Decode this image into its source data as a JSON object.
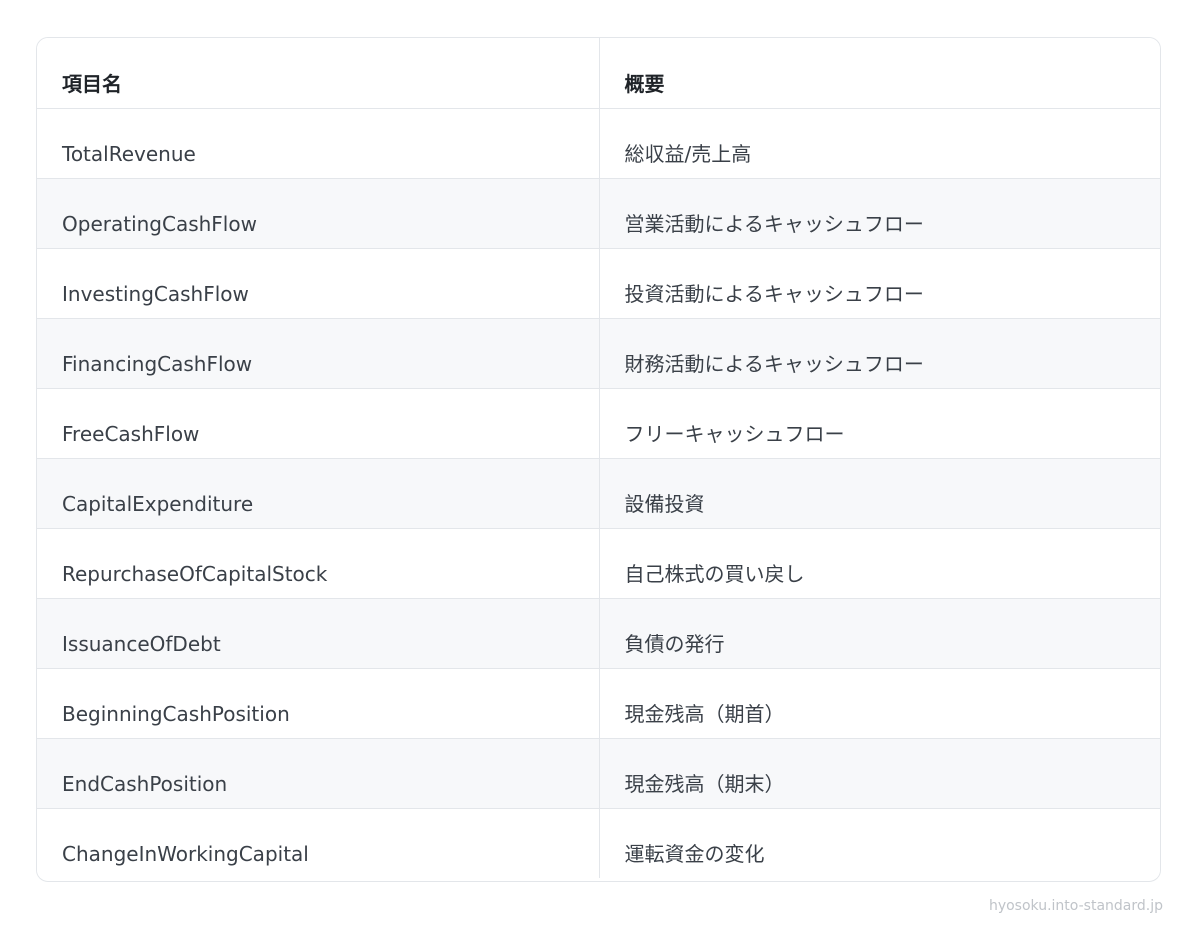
{
  "table": {
    "headers": [
      "項目名",
      "概要"
    ],
    "rows": [
      [
        "TotalRevenue",
        "総収益/売上高"
      ],
      [
        "OperatingCashFlow",
        "営業活動によるキャッシュフロー"
      ],
      [
        "InvestingCashFlow",
        "投資活動によるキャッシュフロー"
      ],
      [
        "FinancingCashFlow",
        "財務活動によるキャッシュフロー"
      ],
      [
        "FreeCashFlow",
        "フリーキャッシュフロー"
      ],
      [
        "CapitalExpenditure",
        "設備投資"
      ],
      [
        "RepurchaseOfCapitalStock",
        "自己株式の買い戻し"
      ],
      [
        "IssuanceOfDebt",
        "負債の発行"
      ],
      [
        "BeginningCashPosition",
        "現金残高（期首）"
      ],
      [
        "EndCashPosition",
        "現金残高（期末）"
      ],
      [
        "ChangeInWorkingCapital",
        "運転資金の変化"
      ]
    ]
  },
  "footer": {
    "watermark": "hyosoku.into-standard.jp"
  }
}
